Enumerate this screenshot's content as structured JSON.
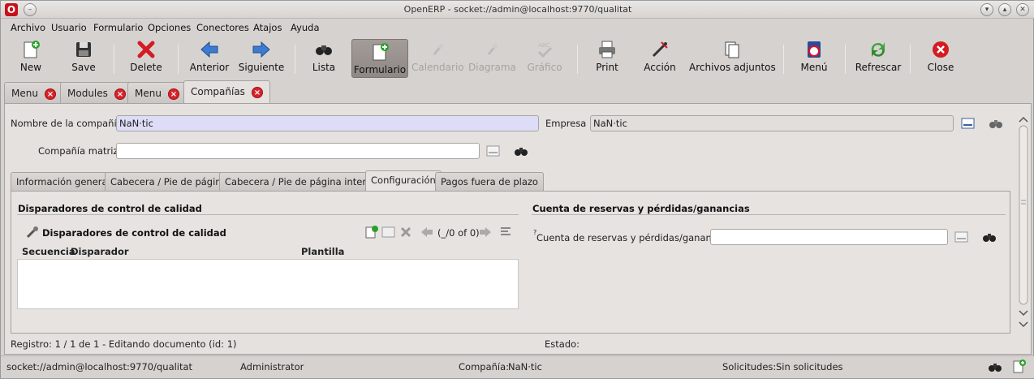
{
  "window": {
    "title": "OpenERP - socket://admin@localhost:9770/qualitat"
  },
  "menubar": {
    "items": [
      "Archivo",
      "Usuario",
      "Formulario",
      "Opciones",
      "Conectores",
      "Atajos",
      "Ayuda"
    ]
  },
  "toolbar": {
    "new": "New",
    "save": "Save",
    "delete": "Delete",
    "previous": "Anterior",
    "next": "Siguiente",
    "list": "Lista",
    "form": "Formulario",
    "calendar": "Calendario",
    "diagram": "Diagrama",
    "graph": "Gráfico",
    "print": "Print",
    "action": "Acción",
    "attachments": "Archivos adjuntos",
    "menu": "Menú",
    "refresh": "Refrescar",
    "close": "Close"
  },
  "doc_tabs": [
    "Menu",
    "Modules",
    "Menu",
    "Compañías"
  ],
  "form": {
    "company_name_label": "Nombre de la compañía :",
    "company_name_value": "NaN·tic",
    "empresa_label": "Empresa :",
    "empresa_value": "NaN·tic",
    "parent_label": "Compañía matriz :",
    "parent_value": ""
  },
  "inner_tabs": [
    "Información general",
    "Cabecera / Pie de página",
    "Cabecera / Pie de página interna",
    "Configuración",
    "Pagos fuera de plazo"
  ],
  "config": {
    "quality_section": "Disparadores de control de calidad",
    "grid_title": "Disparadores de control de calidad",
    "pager": "(_/0 of 0)",
    "columns": [
      "Secuencia",
      "Disparador",
      "Plantilla"
    ],
    "reserve_section": "Cuenta de reservas y pérdidas/ganancias",
    "reserve_help_mark": "?",
    "reserve_label": "Cuenta de reservas y pérdidas/ganancias :",
    "reserve_value": ""
  },
  "record_status": "Registro: 1 / 1 de 1 - Editando documento (id: 1)",
  "estado_label": "Estado:",
  "statusbar": {
    "connection": "socket://admin@localhost:9770/qualitat",
    "user": "Administrator",
    "company_label": "Compañía:",
    "company_value": "NaN·tic",
    "requests_label": "Solicitudes:",
    "requests_value": "Sin solicitudes"
  }
}
